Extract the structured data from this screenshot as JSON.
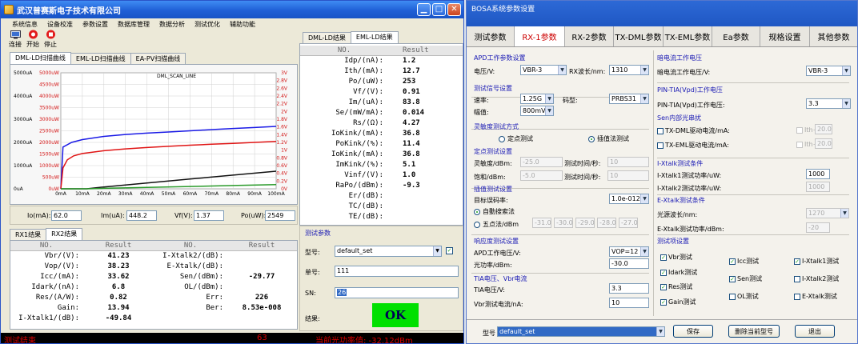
{
  "left_window": {
    "title": "武汉普赛斯电子技术有限公司",
    "menu": [
      "系统信息",
      "设备校准",
      "参数设置",
      "数据库管理",
      "数据分析",
      "测试优化",
      "辅助功能"
    ],
    "toolbar": {
      "connect": "连接",
      "start": "开始",
      "stop": "停止"
    },
    "chart_tabs": [
      "DML-LD扫描曲线",
      "EML-LD扫描曲线",
      "EA-PV扫描曲线"
    ],
    "result_tabs": [
      "DML-LD结果",
      "EML-LD结果"
    ],
    "ld_table": {
      "headers": [
        "NO.",
        "Result"
      ],
      "rows": [
        [
          "Idp/(nA):",
          "1.2"
        ],
        [
          "Ith/(mA):",
          "12.7"
        ],
        [
          "Po/(uW):",
          "253"
        ],
        [
          "Vf/(V):",
          "0.91"
        ],
        [
          "Im/(uA):",
          "83.8"
        ],
        [
          "Se/(mW/mA):",
          "0.014"
        ],
        [
          "Rs/(Ω):",
          "4.27"
        ],
        [
          "IoKink/(mA):",
          "36.8"
        ],
        [
          "PoKink/(%):",
          "11.4"
        ],
        [
          "IoKink/(mA):",
          "36.8"
        ],
        [
          "ImKink/(%):",
          "5.1"
        ],
        [
          "Vinf/(V):",
          "1.0"
        ],
        [
          "RaPo/(dBm):",
          "-9.3"
        ],
        [
          "Er/(dB):",
          ""
        ],
        [
          "TC/(dB):",
          ""
        ],
        [
          "TE/(dB):",
          ""
        ]
      ]
    },
    "info": {
      "io_label": "Io(mA):",
      "io": "62.0",
      "im_label": "Im(uA):",
      "im": "448.2",
      "vf_label": "Vf(V):",
      "vf": "1.37",
      "po_label": "Po(uW):",
      "po": "2549"
    },
    "rx_tabs": [
      "RX1结果",
      "RX2结果"
    ],
    "rx_table": {
      "headers": [
        "NO.",
        "Result",
        "NO.",
        "Result"
      ],
      "rows": [
        [
          "Vbr/(V):",
          "41.23",
          "I-Xtalk2/(dB):",
          ""
        ],
        [
          "Vop/(V):",
          "38.23",
          "E-Xtalk/(dB):",
          ""
        ],
        [
          "Icc/(mA):",
          "33.62",
          "Sen/(dBm):",
          "-29.77"
        ],
        [
          "Idark/(nA):",
          "6.8",
          "OL/(dBm):",
          ""
        ],
        [
          "Res/(A/W):",
          "0.82",
          "Err:",
          "226"
        ],
        [
          "Gain:",
          "13.94",
          "Ber:",
          "8.53e-008"
        ],
        [
          "I-Xtalk1/(dB):",
          "-49.84",
          "",
          ""
        ]
      ]
    },
    "test_params": {
      "title": "测试参数",
      "model_label": "型号:",
      "model": "default_set",
      "order_label": "单号:",
      "order": "111",
      "sn_label": "SN:",
      "sn": "26",
      "result_label": "结果:",
      "result": "OK"
    },
    "status": {
      "left": "测试结束",
      "mid": "63",
      "right": "当前光功率值: -32.12dBm"
    }
  },
  "chart_data": {
    "type": "line",
    "title": "DML_SCAN_LINE",
    "x_ticks": [
      "0mA",
      "10mA",
      "20mA",
      "30mA",
      "40mA",
      "50mA",
      "60mA",
      "70mA",
      "80mA",
      "90mA",
      "100mA"
    ],
    "xlim": [
      0,
      100
    ],
    "y_left_ticks": [
      "5000uA",
      "4000uA",
      "3000uA",
      "2000uA",
      "1000uA",
      "0uA"
    ],
    "y_left_red_ticks": [
      "5000uW",
      "4500uW",
      "4000uW",
      "3500uW",
      "3000uW",
      "2500uW",
      "2000uW",
      "1500uW",
      "1000uW",
      "500uW",
      "0uW"
    ],
    "y_right_ticks": [
      "3V",
      "2.8V",
      "2.6V",
      "2.4V",
      "2.2V",
      "2V",
      "1.8V",
      "1.6V",
      "1.4V",
      "1.2V",
      "1V",
      "0.8V",
      "0.6V",
      "0.4V",
      "0.2V",
      "0V"
    ],
    "ylim_left": [
      0,
      5000
    ],
    "ylim_right": [
      0,
      3
    ],
    "grid": true,
    "series": [
      {
        "color": "#1a1ae6",
        "x": [
          0,
          1,
          5,
          10,
          20,
          30,
          40,
          50,
          60,
          70,
          80,
          90,
          100
        ],
        "y": [
          0,
          1800,
          2000,
          2120,
          2260,
          2340,
          2400,
          2450,
          2500,
          2550,
          2600,
          2640,
          2690
        ]
      },
      {
        "color": "#e01515",
        "x": [
          0,
          1,
          3,
          6,
          10,
          20,
          30,
          40,
          50,
          60,
          70,
          80,
          90,
          100
        ],
        "y": [
          0,
          900,
          1250,
          1420,
          1520,
          1640,
          1720,
          1780,
          1830,
          1880,
          1920,
          1960,
          2000,
          2040
        ]
      },
      {
        "color": "#111111",
        "x": [
          0,
          12,
          20,
          40,
          60,
          80,
          100
        ],
        "y": [
          0,
          0,
          80,
          250,
          420,
          590,
          760
        ]
      },
      {
        "color": "#2a9a2a",
        "x": [
          0,
          12,
          20,
          40,
          60,
          80,
          100
        ],
        "y": [
          0,
          0,
          20,
          60,
          100,
          140,
          180
        ]
      }
    ]
  },
  "right_window": {
    "title": "BOSA系统参数设置",
    "tabs": [
      "测试参数",
      "RX-1参数",
      "RX-2参数",
      "TX-DML参数",
      "TX-EML参数",
      "Ea参数",
      "规格设置",
      "其他参数"
    ],
    "apd": {
      "title": "APD工作参数设置",
      "voltage_label": "电压/V:",
      "voltage": "VBR-3",
      "wavelength_label": "RX波长/nm:",
      "wavelength": "1310"
    },
    "test_signal": {
      "title": "测试信号设置",
      "rate_label": "速率:",
      "rate": "1.25G",
      "pattern_label": "码型:",
      "pattern": "PRBS31",
      "amp_label": "幅值:",
      "amp": "800mV"
    },
    "sens_mode": {
      "title": "灵敏度测试方式",
      "opt1": "定点测试",
      "opt2": "插值法测试"
    },
    "fixed": {
      "title": "定点测试设置",
      "sens_label": "灵敏度/dBm:",
      "sens": "-25.0",
      "time1_label": "测试时间/秒:",
      "time1": "10",
      "sat_label": "饱和/dBm:",
      "sat": "-5.0",
      "time2_label": "测试时间/秒:",
      "time2": "10"
    },
    "interp": {
      "title": "插值测试设置",
      "ber_label": "目标误码率:",
      "ber": "1.0e-012",
      "auto": "自動搜索法",
      "five": "五点法/dBm",
      "points": [
        "-31.0",
        "-30.0",
        "-29.0",
        "-28.0",
        "-27.0"
      ]
    },
    "response": {
      "title": "响应度测试设置",
      "apd_v_label": "APD工作电压/V:",
      "apd_v": "VOP=12",
      "power_label": "光功率/dBm:",
      "power": "-30.0"
    },
    "tia": {
      "title": "TIA电压、Vbr电流",
      "v_label": "TIA电压/V:",
      "v": "3.3",
      "i_label": "Vbr测试电流/nA:",
      "i": "10"
    },
    "dark": {
      "title": "暗电流工作电压",
      "label": "暗电流工作电压/V:",
      "value": "VBR-3"
    },
    "pin_tia": {
      "title": "PIN-TIA(Vpd)工作电压",
      "label": "PIN-TIA(Vpd)工作电压:",
      "value": "3.3"
    },
    "sen_burst": {
      "title": "Sen内部光串扰",
      "dml": "TX-DML驱动电流/mA:",
      "eml": "TX-EML驱动电流/mA:",
      "ith": "Ith+",
      "dml_v": "20.0",
      "eml_v": "20.0"
    },
    "ixtalk": {
      "title": "I-Xtalk测试条件",
      "p1_label": "I-Xtalk1测试功率/uW:",
      "p1": "1000",
      "p2_label": "I-Xtalk2测试功率/uW:",
      "p2": "1000"
    },
    "extalk": {
      "title": "E-Xtalk测试条件",
      "wl_label": "光源波长/nm:",
      "wl": "1270",
      "p_label": "E-Xtalk测试功率/dBm:",
      "p": "-20"
    },
    "items": {
      "title": "测试项设置",
      "list": [
        "Vbr测试",
        "Icc测试",
        "I-Xtalk1测试",
        "Idark测试",
        "Sen测试",
        "I-Xtalk2测试",
        "Res测试",
        "OL测试",
        "E-Xtalk测试",
        "Gain测试"
      ]
    },
    "footer": {
      "model_label": "型号",
      "model": "default_set",
      "save": "保存",
      "delete": "删除当前型号",
      "exit": "退出"
    }
  }
}
